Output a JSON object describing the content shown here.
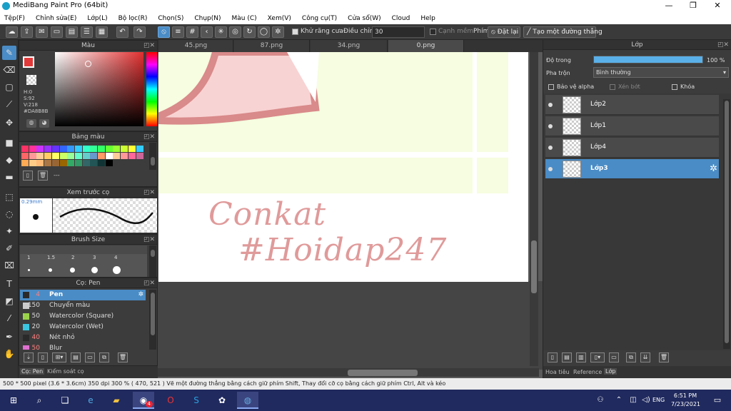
{
  "window": {
    "title": "MediBang Paint Pro (64bit)",
    "minimize": "—",
    "maximize": "❐",
    "close": "✕"
  },
  "menu": [
    "Tệp(F)",
    "Chỉnh sửa(E)",
    "Lớp(L)",
    "Bộ lọc(R)",
    "Chọn(S)",
    "Chụp(N)",
    "Màu (C)",
    "Xem(V)",
    "Công cụ(T)",
    "Cửa sổ(W)",
    "Cloud",
    "Help"
  ],
  "toolbar": {
    "antialias_label": "Khử răng cưa",
    "adjust_label": "Điều chỉnh",
    "adjust_value": "30",
    "edge_label": "Cạnh mềm",
    "shortcut_label": "Phím",
    "reset_label": "Đặt lại",
    "line_label": "Tạo một đường thẳng"
  },
  "color_panel": {
    "title": "Màu",
    "h": "H:0",
    "s": "S:92",
    "v": "V:218",
    "hex": "#DA8B8B",
    "main_color": "#e23a3a"
  },
  "palette_panel": {
    "title": "Bảng màu",
    "dash": "---",
    "swatches": [
      "#ff3366",
      "#ff3399",
      "#cc33ff",
      "#9933ff",
      "#6633ff",
      "#3366ff",
      "#3399ff",
      "#33ccff",
      "#33ffcc",
      "#33ff99",
      "#33ff66",
      "#66ff33",
      "#99ff33",
      "#ccff33",
      "#ffff33",
      "#33ccff",
      "#ff6666",
      "#ff9999",
      "#ffcc99",
      "#ffcc66",
      "#ffff66",
      "#ccff66",
      "#99ff99",
      "#66ffcc",
      "#66cccc",
      "#6699cc",
      "#ff9966",
      "#ffffff",
      "#ffcc99",
      "#ff9999",
      "#ff6699",
      "#cc6699",
      "#ffaa55",
      "#ffcc88",
      "#ffbb77",
      "#aa7744",
      "#996633",
      "#996600",
      "#33aa66",
      "#339966",
      "#336666",
      "#225555",
      "#113333",
      "#000000"
    ]
  },
  "preview_panel": {
    "title": "Xem trước cọ",
    "size": "0.29mm"
  },
  "brush_size_panel": {
    "title": "Brush Size",
    "sizes": [
      "1",
      "1.5",
      "2",
      "3",
      "4"
    ]
  },
  "brush_panel": {
    "title": "Cọ: Pen",
    "items": [
      {
        "num": "4",
        "name": "Pen",
        "color": "#2a2a2a",
        "numcolor": "#ff8080"
      },
      {
        "num": "150",
        "name": "Chuyển màu",
        "color": "#cccccc",
        "numcolor": "#dddddd"
      },
      {
        "num": "50",
        "name": "Watercolor (Square)",
        "color": "#9ad24a",
        "numcolor": "#dddddd"
      },
      {
        "num": "20",
        "name": "Watercolor (Wet)",
        "color": "#3ac6e0",
        "numcolor": "#dddddd"
      },
      {
        "num": "40",
        "name": "Nét nhỏ",
        "color": "#2a2a2a",
        "numcolor": "#ff8080"
      },
      {
        "num": "50",
        "name": "Blur",
        "color": "#e070d0",
        "numcolor": "#ff8080"
      }
    ]
  },
  "bottom_tabs": {
    "pen": "Cọ: Pen",
    "control": "Kiểm soát cọ"
  },
  "canvas_tabs": [
    "45.png",
    "87.png",
    "34.png",
    "0.png"
  ],
  "canvas_text": {
    "line1": "Conkat",
    "line2": "#Hoidap247"
  },
  "layer_panel": {
    "title": "Lớp",
    "opacity_label": "Độ trong",
    "opacity_value": "100 %",
    "opacity_fraction": 1.0,
    "blend_label": "Pha trộn",
    "blend_value": "Bình thường",
    "protect_alpha": "Bảo vệ alpha",
    "clip": "Xén bớt",
    "lock": "Khóa",
    "layers": [
      "Lớp2",
      "Lớp1",
      "Lớp4",
      "Lớp3"
    ]
  },
  "right_tabs": {
    "title_tab": "Hoa tiêu",
    "reference_tab": "Reference",
    "layer_tab": "Lớp"
  },
  "status": "500 * 500 pixel   (3.6 * 3.6cm)   350 dpi   300 %   ( 470, 521 )   Vẽ một đường thẳng bằng cách giữ phím Shift, Thay đổi cỡ cọ bằng cách giữ phím Ctrl, Alt và kéo",
  "taskbar": {
    "lang": "ENG",
    "time": "6:51 PM",
    "date": "7/23/2021",
    "badge": "4",
    "notif": "1"
  }
}
